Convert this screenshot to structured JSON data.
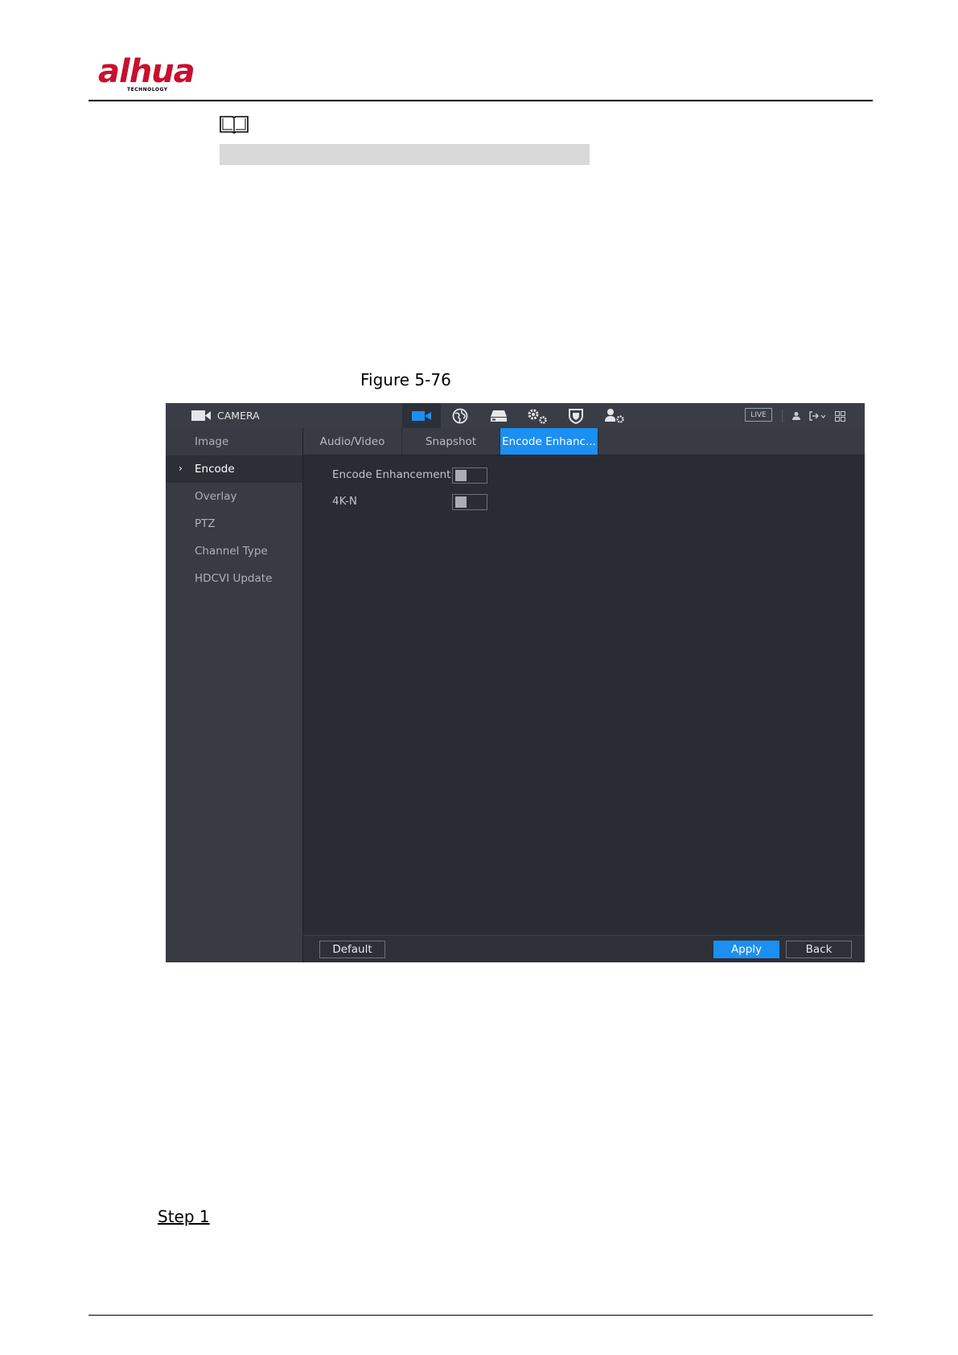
{
  "document": {
    "brand": "alhua",
    "brand_tagline": "TECHNOLOGY",
    "figure_caption": "Figure 5-76",
    "step_label": "Step 1"
  },
  "ui": {
    "header": {
      "title": "CAMERA",
      "live_label": "LIVE",
      "icons": [
        "camera-icon",
        "network-globe-icon",
        "storage-icon",
        "system-settings-icon",
        "security-shield-icon",
        "account-settings-icon"
      ],
      "active_icon": "camera-icon"
    },
    "sidebar": {
      "items": [
        {
          "label": "Image",
          "active": false
        },
        {
          "label": "Encode",
          "active": true
        },
        {
          "label": "Overlay",
          "active": false
        },
        {
          "label": "PTZ",
          "active": false
        },
        {
          "label": "Channel Type",
          "active": false
        },
        {
          "label": "HDCVI Update",
          "active": false
        }
      ],
      "active_marker": "›"
    },
    "tabs": [
      {
        "label": "Audio/Video",
        "active": false
      },
      {
        "label": "Snapshot",
        "active": false
      },
      {
        "label": "Encode Enhanc...",
        "active": true
      }
    ],
    "settings": [
      {
        "label": "Encode Enhancement",
        "enabled": false
      },
      {
        "label": "4K-N",
        "enabled": false
      }
    ],
    "footer": {
      "default_label": "Default",
      "apply_label": "Apply",
      "back_label": "Back"
    },
    "colors": {
      "accent": "#1b8ff2",
      "background": "#2a2c33",
      "sidebar": "#383b44"
    }
  }
}
